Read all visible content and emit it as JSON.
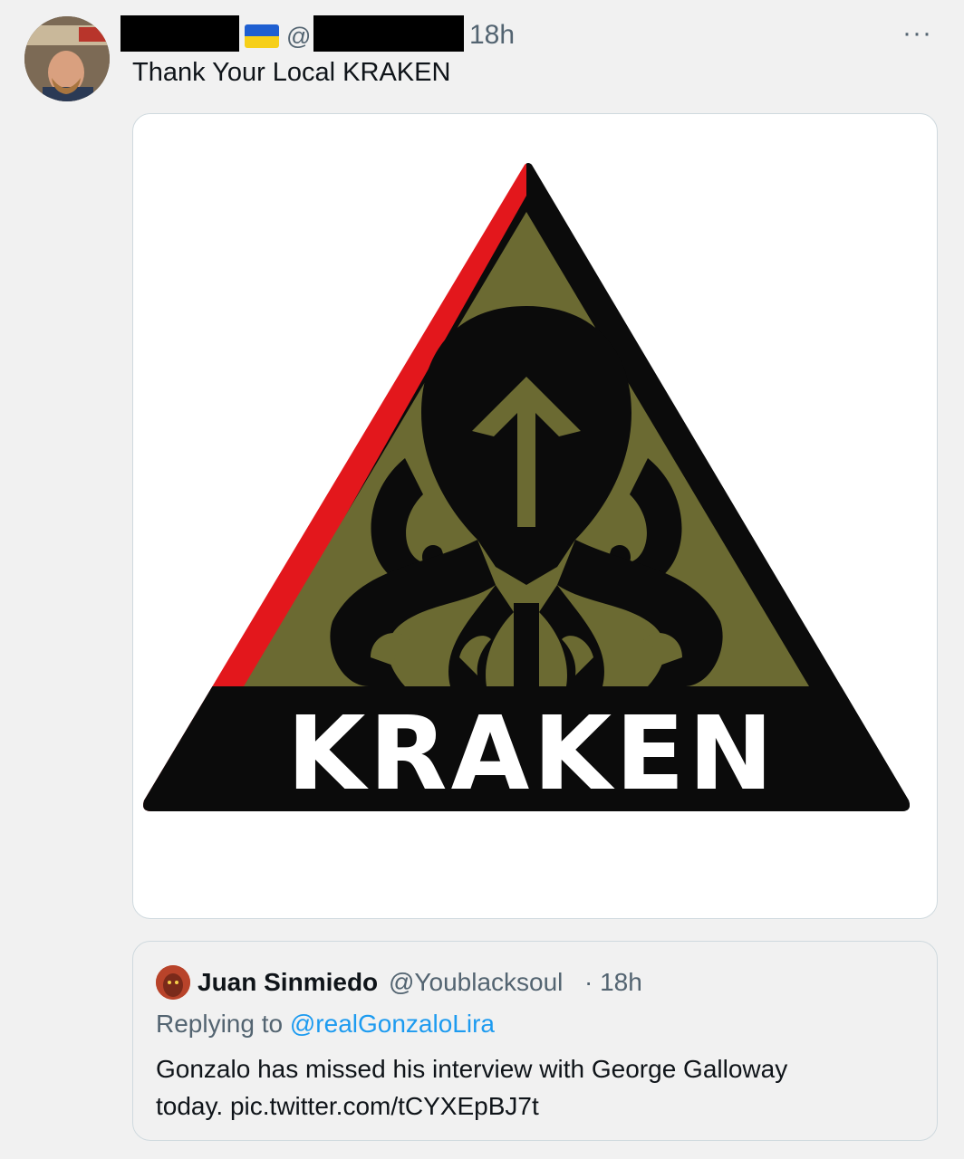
{
  "tweet": {
    "handle_prefix": "@",
    "time": "18h",
    "more_label": "···",
    "text": "Thank Your Local KRAKEN"
  },
  "media": {
    "logo_text": "KRAKEN",
    "colors": {
      "red": "#e3171c",
      "black": "#0b0b0b",
      "olive": "#6b6a32",
      "white": "#ffffff"
    }
  },
  "quote": {
    "name": "Juan Sinmiedo",
    "handle": "@Youblacksoul",
    "time": "· 18h",
    "replying_prefix": "Replying to ",
    "replying_handle": "@realGonzaloLira",
    "text_line1": "Gonzalo has missed his interview with George Galloway",
    "text_line2": "today. pic.twitter.com/tCYXEpBJ7t"
  },
  "icons": [
    "ukraine-flag-icon",
    "more-icon"
  ]
}
